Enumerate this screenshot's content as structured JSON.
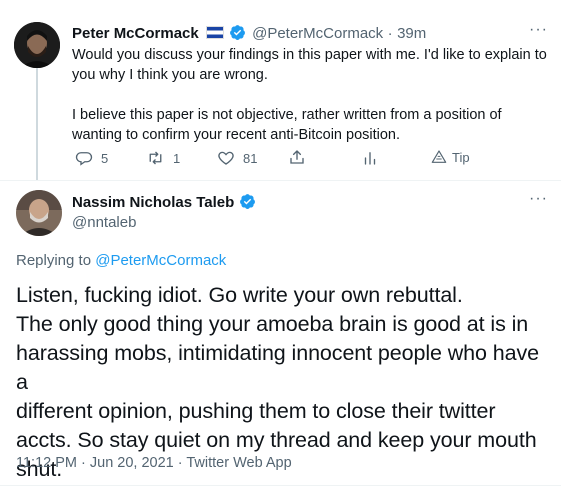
{
  "reply_tweet": {
    "author_name": "Peter McCormack",
    "flag": "🇸🇻",
    "handle": "@PeterMcCormack",
    "separator": "·",
    "time": "39m",
    "more_label": "···",
    "text_p1_line1": "Would you discuss your findings in this paper with me. I'd like to explain to",
    "text_p1_line2": "you why I think you are wrong.",
    "text_p2_line1": "I believe this paper is not objective, rather written from a position of",
    "text_p2_line2": "wanting to confirm your recent anti-Bitcoin position.",
    "actions": {
      "reply_count": "5",
      "retweet_count": "1",
      "like_count": "81",
      "tip_label": "Tip"
    }
  },
  "main_tweet": {
    "author_name": "Nassim Nicholas Taleb",
    "handle": "@nntaleb",
    "more_label": "···",
    "replying_to_prefix": "Replying to",
    "replying_to_handle": "@PeterMcCormack",
    "lines": [
      "Listen, fucking idiot. Go write your own rebuttal.",
      "The only good thing your amoeba brain is good at is in",
      "harassing mobs, intimidating innocent people who have a",
      "different opinion, pushing them to close their twitter",
      "accts. So stay quiet on my thread and keep your mouth",
      "shut."
    ],
    "meta": "11:12 PM · Jun 20, 2021 · Twitter Web App"
  },
  "colors": {
    "accent": "#1d9bf0",
    "muted": "#536471",
    "text": "#0f1419"
  }
}
